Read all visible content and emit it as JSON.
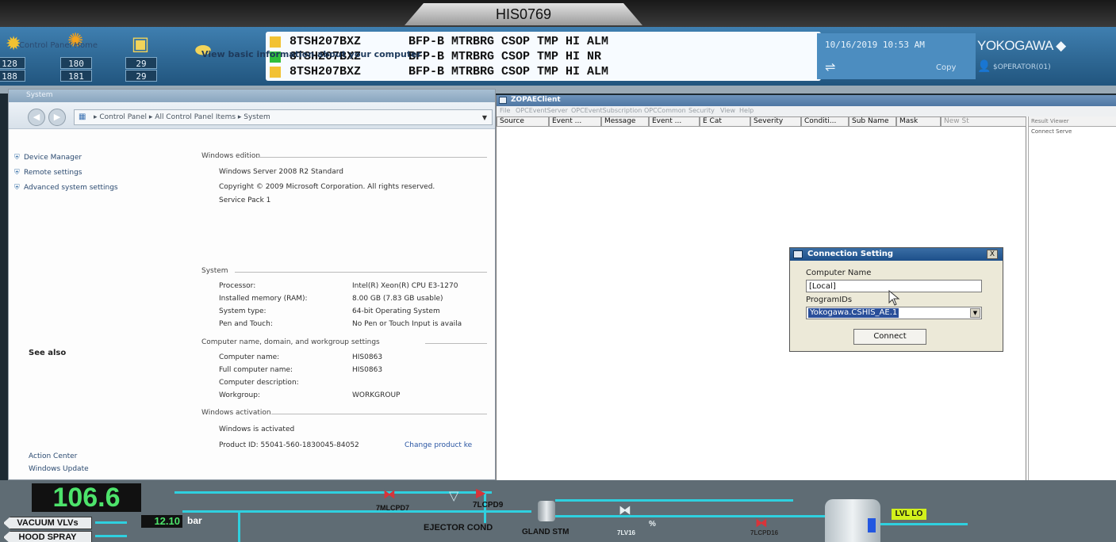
{
  "screen": {
    "host_label": "HIS0769",
    "header": {
      "icon_counts": [
        {
          "icon": "alarm-sun-icon",
          "top": "128",
          "bottom": "188"
        },
        {
          "icon": "process-alarm-icon",
          "top": "180",
          "bottom": "181"
        },
        {
          "icon": "system-alarm-icon",
          "top": "29",
          "bottom": "29"
        },
        {
          "icon": "message-icon",
          "top": "",
          "bottom": ""
        }
      ],
      "alarms": [
        {
          "color": "#f2c232",
          "tag": "8TSH207BXZ",
          "message": "BFP-B MTRBRG CSOP TMP HI ALM"
        },
        {
          "color": "#2fbf3c",
          "tag": "8TSH207BXZ",
          "message": "BFP-B MTRBRG CSOP TMP HI NR"
        },
        {
          "color": "#f2c232",
          "tag": "8TSH207BXZ",
          "message": "BFP-B MTRBRG CSOP TMP HI ALM"
        }
      ],
      "datetime": "10/16/2019 10:53 AM",
      "copy_label": "Copy",
      "brand": "YOKOGAWA ◆",
      "operator": "$OPERATOR(01)"
    }
  },
  "system_window": {
    "title": "System",
    "address_path": "▸ Control Panel ▸ All Control Panel Items ▸ System",
    "sidebar": {
      "home": "Control Panel Home",
      "links": [
        "Device Manager",
        "Remote settings",
        "Advanced system settings"
      ],
      "see_also": "See also",
      "see_also_links": [
        "Action Center",
        "Windows Update"
      ]
    },
    "heading": "View basic information about your computer",
    "edition_section": "Windows edition",
    "edition": {
      "name": "Windows Server 2008 R2 Standard",
      "copyright": "Copyright © 2009 Microsoft Corporation.  All rights reserved.",
      "service_pack": "Service Pack 1"
    },
    "system_section": "System",
    "system_rows": [
      {
        "key": "Processor:",
        "value": "Intel(R) Xeon(R) CPU E3-1270"
      },
      {
        "key": "Installed memory (RAM):",
        "value": "8.00 GB (7.83 GB usable)"
      },
      {
        "key": "System type:",
        "value": "64-bit Operating System"
      },
      {
        "key": "Pen and Touch:",
        "value": "No Pen or Touch Input is availa"
      }
    ],
    "computer_section": "Computer name, domain, and workgroup settings",
    "computer_rows": [
      {
        "key": "Computer name:",
        "value": "HIS0863"
      },
      {
        "key": "Full computer name:",
        "value": "HIS0863"
      },
      {
        "key": "Computer description:",
        "value": ""
      },
      {
        "key": "Workgroup:",
        "value": "WORKGROUP"
      }
    ],
    "activation_section": "Windows activation",
    "activation_status": "Windows is activated",
    "product_id": "Product ID: 55041-560-1830045-84052",
    "change_key": "Change product ke"
  },
  "ae_client": {
    "title": "ZOPAEClient",
    "menu": [
      "File",
      "OPCEventServer",
      "OPCEventSubscription",
      "OPCCommon",
      "Security",
      "View",
      "Help"
    ],
    "columns": [
      "Source",
      "Event ...",
      "Message",
      "Event ...",
      "E Cat",
      "Severity",
      "Conditi...",
      "Sub Name",
      "Mask",
      "New St"
    ],
    "result_header": "Result Viewer",
    "result_line": "Connect Serve"
  },
  "connection_dialog": {
    "title": "Connection Setting",
    "close": "X",
    "computer_name_label": "Computer Name",
    "computer_name_value": "[Local]",
    "program_ids_label": "ProgramIDs",
    "program_id_value": "Yokogawa.CSHIS_AE.1",
    "connect_label": "Connect"
  },
  "graphic": {
    "main_value": "106.6",
    "buttons": [
      "VACUUM VLVs",
      "HOOD SPRAY"
    ],
    "pressure_value": "12.10",
    "pressure_unit": "bar",
    "labels": {
      "v1": "7MLCPD7",
      "v2": "7LCPD9",
      "ejector": "EJECTOR COND",
      "gland": "GLAND STM",
      "v3": "7LV16",
      "pct": "%",
      "v4": "7LCPD16"
    },
    "level_alarm": "LVL LO"
  }
}
